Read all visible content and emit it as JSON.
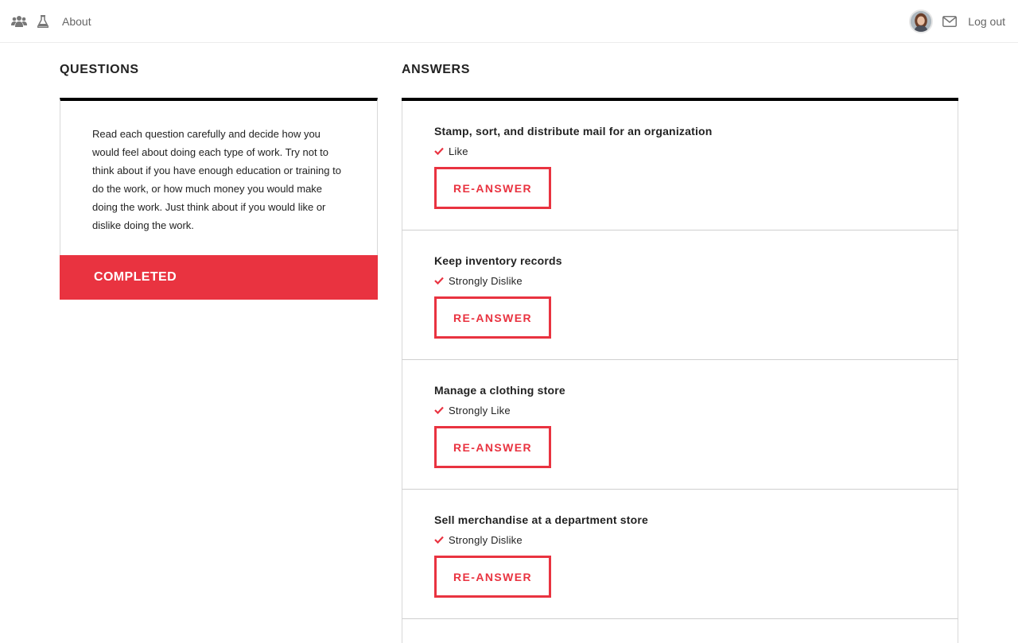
{
  "nav": {
    "about_label": "About",
    "logout_label": "Log out",
    "icons": [
      "group-icon",
      "flask-icon",
      "mail-icon"
    ]
  },
  "questions": {
    "title": "QUESTIONS",
    "instructions": "Read each question carefully and decide how you would feel about doing each type of work. Try not to think about if you have enough education or training to do the work, or how much money you would make doing the work. Just think about if you would like or dislike doing the work.",
    "status_label": "COMPLETED"
  },
  "answers": {
    "title": "ANSWERS",
    "items": [
      {
        "question": "Stamp, sort, and distribute mail for an organization",
        "response": "Like",
        "button_label": "RE-ANSWER"
      },
      {
        "question": "Keep inventory records",
        "response": "Strongly Dislike",
        "button_label": "RE-ANSWER"
      },
      {
        "question": "Manage a clothing store",
        "response": "Strongly Like",
        "button_label": "RE-ANSWER"
      },
      {
        "question": "Sell merchandise at a department store",
        "response": "Strongly Dislike",
        "button_label": "RE-ANSWER"
      }
    ]
  },
  "colors": {
    "accent": "#e93340",
    "rule": "#000000",
    "border": "#d8d8d8",
    "muted_text": "#666666"
  }
}
